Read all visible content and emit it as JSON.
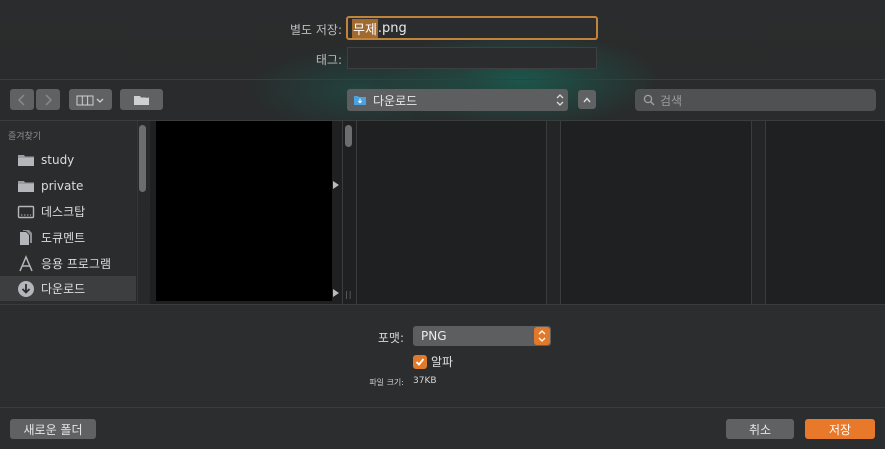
{
  "form": {
    "save_as_label": "별도 저장:",
    "filename_selected": "무제",
    "filename_ext": ".png",
    "tags_label": "태그:",
    "tags_value": ""
  },
  "toolbar": {
    "location": "다운로드",
    "search_placeholder": "검색"
  },
  "sidebar": {
    "heading": "즐겨찾기",
    "items": [
      {
        "label": "study",
        "icon": "folder-icon"
      },
      {
        "label": "private",
        "icon": "folder-icon"
      },
      {
        "label": "데스크탑",
        "icon": "desktop-icon"
      },
      {
        "label": "도큐멘트",
        "icon": "documents-icon"
      },
      {
        "label": "응용 프로그램",
        "icon": "applications-icon"
      },
      {
        "label": "다운로드",
        "icon": "download-icon",
        "active": true
      }
    ]
  },
  "options": {
    "format_label": "포맷:",
    "format_value": "PNG",
    "alpha_label": "알파",
    "alpha_checked": true,
    "filesize_label": "파일 크기:",
    "filesize_value": "37KB"
  },
  "buttons": {
    "new_folder": "새로운 폴더",
    "cancel": "취소",
    "save": "저장"
  },
  "colors": {
    "accent": "#e8782a",
    "focus_ring": "#c2833a"
  }
}
